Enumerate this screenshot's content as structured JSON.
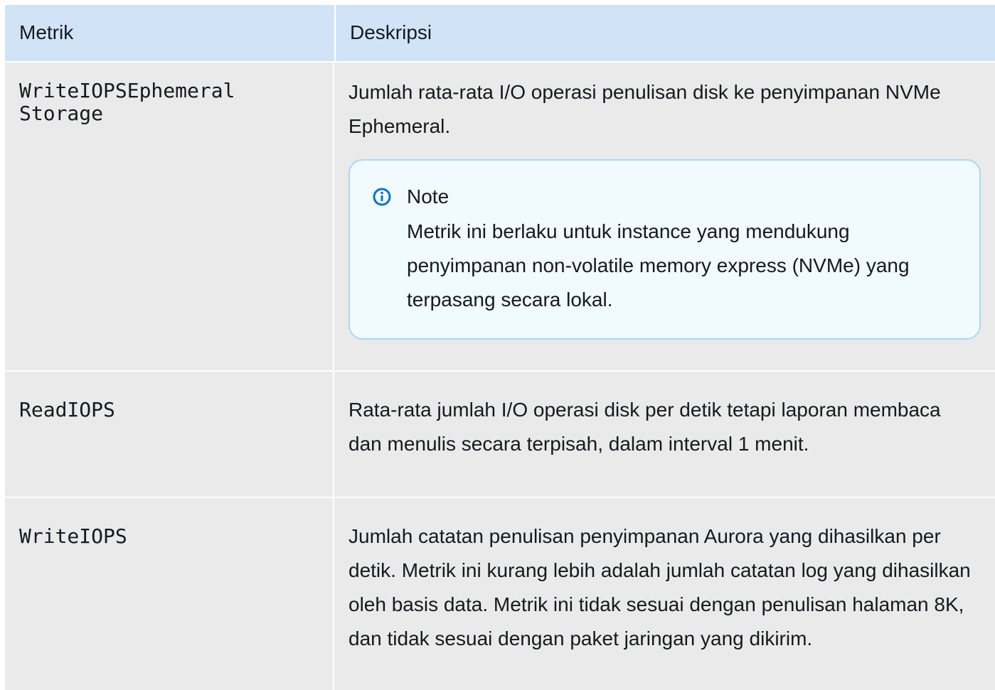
{
  "table": {
    "headers": {
      "metric": "Metrik",
      "description": "Deskripsi"
    },
    "rows": [
      {
        "metric": "WriteIOPSEphemeral\nStorage",
        "description": "Jumlah rata-rata I/O operasi penulisan disk ke penyimpanan NVMe Ephemeral.",
        "note": {
          "icon": "info-icon",
          "title": "Note",
          "body": "Metrik ini berlaku untuk instance yang mendukung penyimpanan non-volatile memory express (NVMe) yang terpasang secara lokal."
        }
      },
      {
        "metric": "ReadIOPS",
        "description": "Rata-rata jumlah I/O operasi disk per detik tetapi laporan membaca dan menulis secara terpisah, dalam interval 1 menit."
      },
      {
        "metric": "WriteIOPS",
        "description": "Jumlah catatan penulisan penyimpanan Aurora yang dihasilkan per detik. Metrik ini kurang lebih adalah jumlah catatan log yang dihasilkan oleh basis data. Metrik ini tidak sesuai dengan penulisan halaman 8K, dan tidak sesuai dengan paket jaringan yang dikirim."
      }
    ]
  },
  "colors": {
    "header_bg": "#d1e4f7",
    "row_bg": "#eaeaea",
    "note_bg": "#f1faff",
    "note_border": "#aad6f5",
    "info_icon": "#0972d3"
  }
}
